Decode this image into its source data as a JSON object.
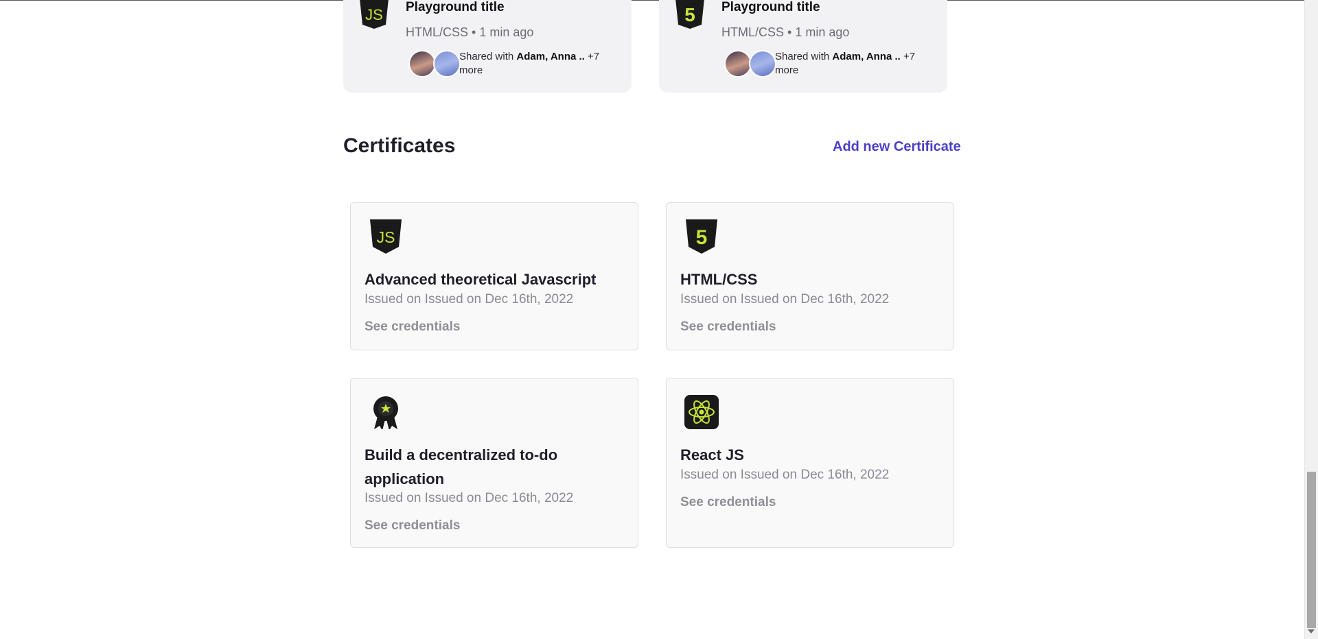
{
  "playgrounds": [
    {
      "title": "Playground title",
      "meta": "HTML/CSS • 1 min ago",
      "shared_prefix": "Shared with ",
      "shared_names": "Adam, Anna ..",
      "shared_more": " +7 more",
      "logo_icon": "js-shield-icon"
    },
    {
      "title": "Playground title",
      "meta": "HTML/CSS • 1 min ago",
      "shared_prefix": "Shared with ",
      "shared_names": "Adam, Anna ..",
      "shared_more": " +7 more",
      "logo_icon": "html5-shield-icon"
    }
  ],
  "certificates_section": {
    "title": "Certificates",
    "add_link": "Add new Certificate",
    "link_color": "#4a3fc8"
  },
  "certificates": [
    {
      "title": "Advanced theoretical Javascript",
      "issued": "Issued on Issued on Dec 16th, 2022",
      "link": "See credentials",
      "icon": "js-shield-icon"
    },
    {
      "title": "HTML/CSS",
      "issued": "Issued on Issued on Dec 16th, 2022",
      "link": "See credentials",
      "icon": "html5-shield-icon"
    },
    {
      "title": "Build a decentralized to-do application",
      "issued": "Issued on Issued on Dec 16th, 2022",
      "link": "See credentials",
      "icon": "award-ribbon-icon"
    },
    {
      "title": "React JS",
      "issued": "Issued on Issued on Dec 16th, 2022",
      "link": "See credentials",
      "icon": "react-icon"
    }
  ],
  "colors": {
    "accent_green": "#c6e43a",
    "icon_dark": "#1a1a1a"
  }
}
